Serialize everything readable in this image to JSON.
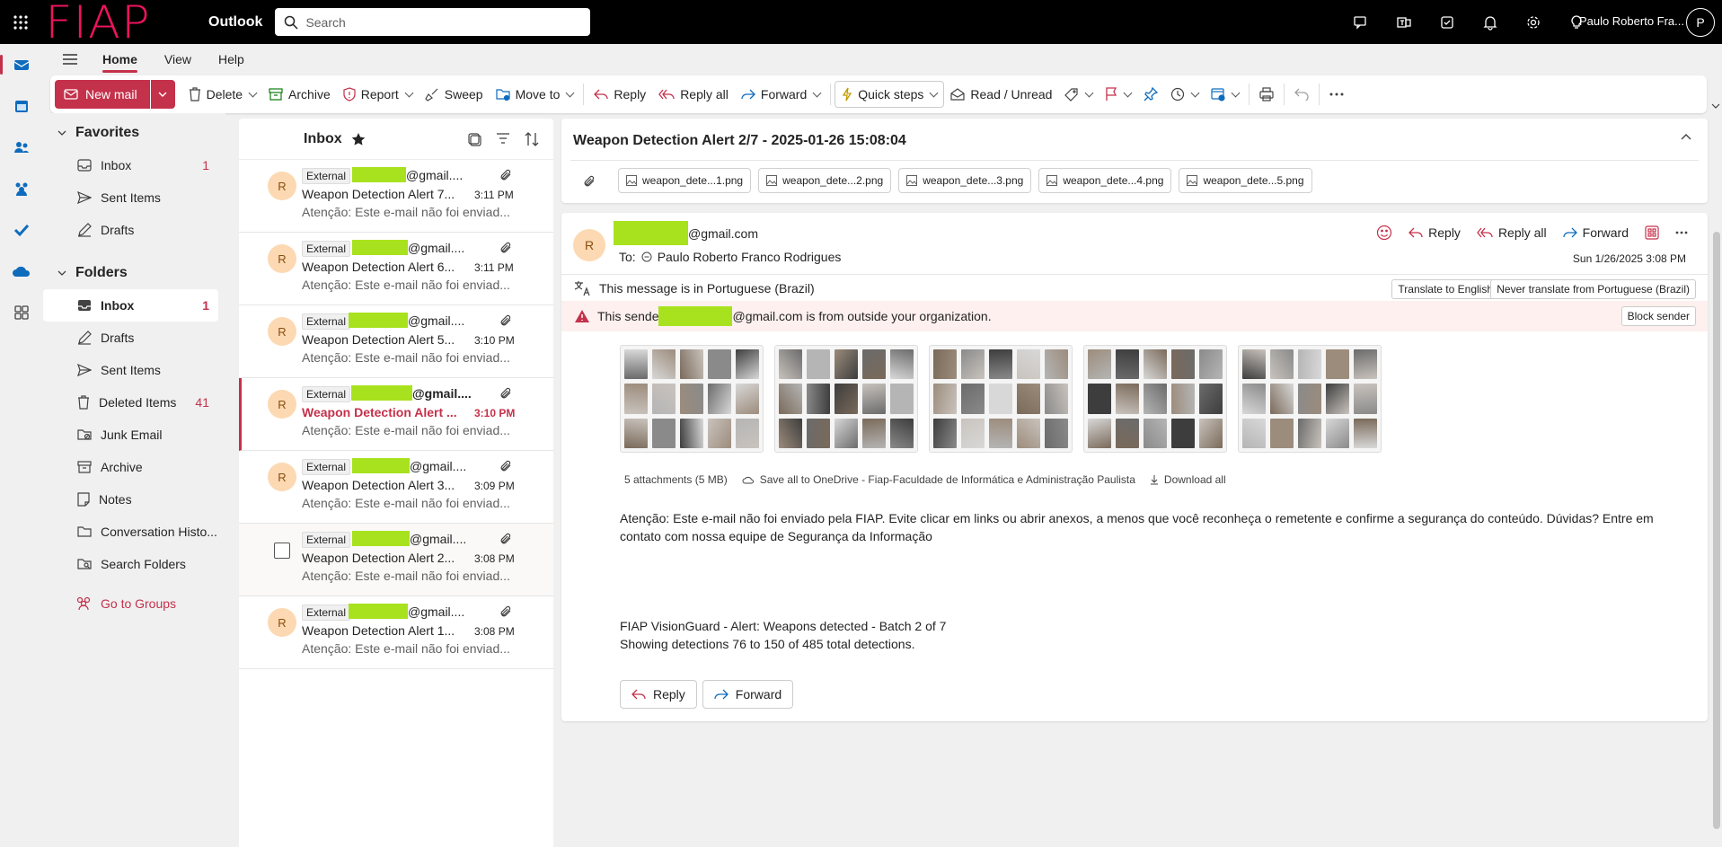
{
  "topbar": {
    "logo": "FIAP",
    "app_name": "Outlook",
    "search_placeholder": "Search",
    "user_name": "Paulo Roberto Fra...",
    "user_initial": "P"
  },
  "tabs": [
    {
      "label": "Home"
    },
    {
      "label": "View"
    },
    {
      "label": "Help"
    }
  ],
  "ribbon": {
    "new_mail": "New mail",
    "delete": "Delete",
    "archive": "Archive",
    "report": "Report",
    "sweep": "Sweep",
    "move_to": "Move to",
    "reply": "Reply",
    "reply_all": "Reply all",
    "forward": "Forward",
    "quick_steps": "Quick steps",
    "read_unread": "Read / Unread"
  },
  "folders": {
    "favorites_label": "Favorites",
    "favorites": [
      {
        "label": "Inbox",
        "count": "1"
      },
      {
        "label": "Sent Items",
        "count": ""
      },
      {
        "label": "Drafts",
        "count": ""
      }
    ],
    "folders_label": "Folders",
    "items": [
      {
        "label": "Inbox",
        "count": "1"
      },
      {
        "label": "Drafts",
        "count": ""
      },
      {
        "label": "Sent Items",
        "count": ""
      },
      {
        "label": "Deleted Items",
        "count": "41"
      },
      {
        "label": "Junk Email",
        "count": ""
      },
      {
        "label": "Archive",
        "count": ""
      },
      {
        "label": "Notes",
        "count": ""
      },
      {
        "label": "Conversation Histo...",
        "count": ""
      },
      {
        "label": "Search Folders",
        "count": ""
      }
    ],
    "groups": "Go to Groups"
  },
  "message_list": {
    "title": "Inbox",
    "messages": [
      {
        "avatar": "R",
        "tag": "External",
        "sender_suffix": "@gmail....",
        "subject": "Weapon Detection Alert 7...",
        "time": "3:11 PM",
        "preview": "Atenção: Este e-mail não foi enviad..."
      },
      {
        "avatar": "R",
        "tag": "External",
        "sender_suffix": "@gmail....",
        "subject": "Weapon Detection Alert 6...",
        "time": "3:11 PM",
        "preview": "Atenção: Este e-mail não foi enviad..."
      },
      {
        "avatar": "R",
        "tag": "External",
        "sender_suffix": "@gmail....",
        "subject": "Weapon Detection Alert 5...",
        "time": "3:10 PM",
        "preview": "Atenção: Este e-mail não foi enviad..."
      },
      {
        "avatar": "R",
        "tag": "External",
        "sender_suffix": "@gmail....",
        "subject": "Weapon Detection Alert ...",
        "time": "3:10 PM",
        "preview": "Atenção: Este e-mail não foi enviad..."
      },
      {
        "avatar": "R",
        "tag": "External",
        "sender_suffix": "@gmail....",
        "subject": "Weapon Detection Alert 3...",
        "time": "3:09 PM",
        "preview": "Atenção: Este e-mail não foi enviad..."
      },
      {
        "avatar": "",
        "tag": "External",
        "sender_suffix": "@gmail....",
        "subject": "Weapon Detection Alert 2...",
        "time": "3:08 PM",
        "preview": "Atenção: Este e-mail não foi enviad..."
      },
      {
        "avatar": "R",
        "tag": "External",
        "sender_suffix": "@gmail....",
        "subject": "Weapon Detection Alert 1...",
        "time": "3:08 PM",
        "preview": "Atenção: Este e-mail não foi enviad..."
      }
    ]
  },
  "reading": {
    "subject": "Weapon Detection Alert 2/7 - 2025-01-26 15:08:04",
    "attachments": [
      "weapon_dete...1.png",
      "weapon_dete...2.png",
      "weapon_dete...3.png",
      "weapon_dete...4.png",
      "weapon_dete...5.png"
    ],
    "avatar": "R",
    "from_suffix": "@gmail.com",
    "to_label": "To:",
    "to_name": "Paulo Roberto Franco Rodrigues",
    "actions": {
      "reply": "Reply",
      "reply_all": "Reply all",
      "forward": "Forward"
    },
    "date": "Sun 1/26/2025 3:08 PM",
    "translate_msg": "This message is in Portuguese (Brazil)",
    "translate_btn": "Translate to English",
    "never_translate_btn": "Never translate from Portuguese (Brazil)",
    "warning_prefix": "This sende",
    "warning_suffix": "@gmail.com is from outside your organization.",
    "block_sender": "Block sender",
    "att_count": "5 attachments (5 MB)",
    "save_onedrive": "Save all to OneDrive - Fiap-Faculdade de Informática e Administração Paulista",
    "download_all": "Download all",
    "body_line1": "Atenção: Este e-mail não foi enviado pela FIAP. Evite clicar em links ou abrir anexos, a menos que você reconheça o remetente e confirme a segurança do conteúdo. Dúvidas? Entre em contato com nossa equipe de Segurança da Informação",
    "body_line2": "FIAP VisionGuard - Alert: Weapons detected - Batch 2 of 7",
    "body_line3": "Showing detections 76 to 150 of 485 total detections.",
    "reply_btn": "Reply",
    "forward_btn": "Forward"
  },
  "colors": {
    "accent": "#c4314b",
    "redaction": "#a8e21e",
    "avatar_bg": "#fcd9b2"
  }
}
